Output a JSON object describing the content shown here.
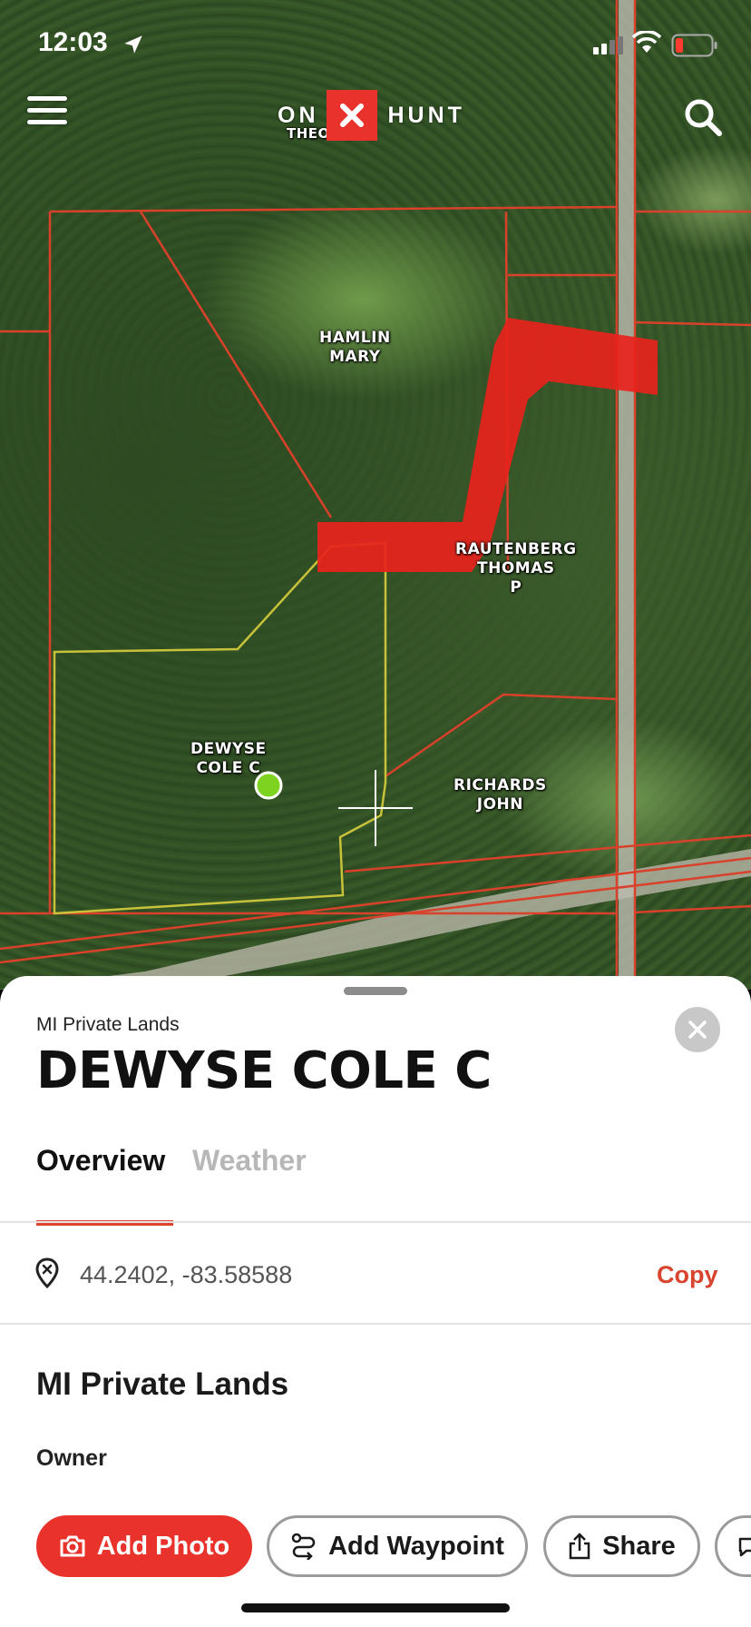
{
  "status_bar": {
    "time": "12:03",
    "icons": [
      "location-arrow-icon",
      "signal-icon",
      "wifi-icon",
      "battery-low-icon"
    ]
  },
  "nav": {
    "logo_left": "ON",
    "logo_right": "HUNT",
    "menu_icon": "hamburger-icon",
    "search_icon": "search-icon"
  },
  "map": {
    "parcels": [
      {
        "line1": "HAMLIN",
        "line2": "MARY",
        "line3": ""
      },
      {
        "line1": "RAUTENBERG",
        "line2": "THOMAS",
        "line3": "P"
      },
      {
        "line1": "DEWYSE",
        "line2": "COLE C",
        "line3": ""
      },
      {
        "line1": "RICHARDS",
        "line2": "JOHN",
        "line3": ""
      }
    ],
    "partial_label": "THEO",
    "colors": {
      "boundary": "#d9412b",
      "selected": "#c8c23a",
      "track": "#e8231c",
      "pin": "#7ed321"
    }
  },
  "sheet": {
    "subtitle": "MI Private Lands",
    "title": "DEWYSE COLE C",
    "tabs": [
      "Overview",
      "Weather"
    ],
    "coordinates": "44.2402, -83.58588",
    "copy_label": "Copy",
    "section_title": "MI Private Lands",
    "owner_label": "Owner",
    "actions": {
      "add_photo": "Add Photo",
      "add_waypoint": "Add Waypoint",
      "share": "Share"
    },
    "accent_color": "#e8322b"
  }
}
